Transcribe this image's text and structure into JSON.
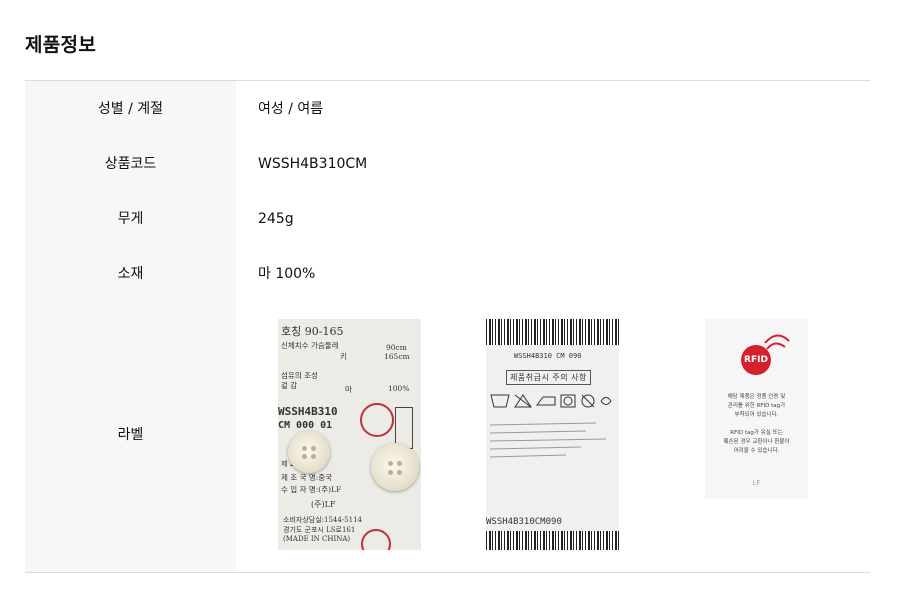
{
  "section": {
    "title": "제품정보"
  },
  "rows": [
    {
      "label": "성별 / 계절",
      "value": "여성 / 여름"
    },
    {
      "label": "상품코드",
      "value": "WSSH4B310CM"
    },
    {
      "label": "무게",
      "value": "245g"
    },
    {
      "label": "소재",
      "value": "마 100%"
    },
    {
      "label": "라벨"
    }
  ],
  "label_images": {
    "care_label": {
      "size": "호칭   90-165",
      "body_size": "신체치수 가슴둘레",
      "bust": "90cm",
      "height_label": "키",
      "height": "165cm",
      "fiber": "섬유의 조성",
      "outer": "겉 감",
      "material": "마",
      "material_pct": "100%",
      "code": "WSSH4B310",
      "code2": "CM 000 01",
      "date": "제        2024.11",
      "country": "제 조 국 명:중국",
      "importer": "수 입 자 명:(주)LF",
      "lf": "(주)LF",
      "phone": "소비자상담실:1544-5114",
      "address": "경기도 군포시 LS로161",
      "made_in": "(MADE IN CHINA)"
    },
    "care_tag": {
      "top_code": "WSSH4B310 CM 090",
      "care_title": "제품취급시 주의 사항",
      "bottom_code": "WSSH4B310CM090"
    },
    "rfid_card": {
      "badge": "RFID",
      "line1": "해당 제품은 정품 인증 및",
      "line2": "관리를 위한 RFID tag가",
      "line3": "부착되어 있습니다.",
      "line4": "RFID tag가 유실 또는",
      "line5": "훼손된 경우 교환이나 환불이",
      "line6": "어려울 수 있습니다.",
      "logo": "LF"
    }
  }
}
